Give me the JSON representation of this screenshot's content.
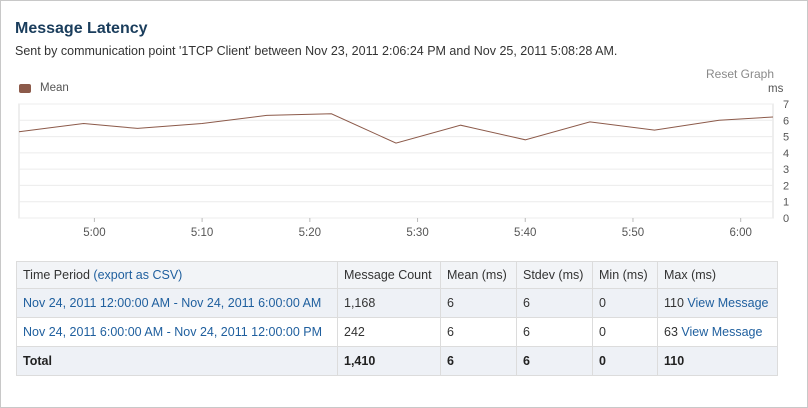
{
  "header": {
    "title": "Message Latency",
    "subtitle": "Sent by communication point '1TCP Client' between Nov 23, 2011 2:06:24 PM and Nov 25, 2011 5:08:28 AM."
  },
  "chart_controls": {
    "reset_label": "Reset Graph",
    "units_label": "ms"
  },
  "chart_data": {
    "type": "line",
    "x": [
      "4:53",
      "4:59",
      "5:04",
      "5:10",
      "5:16",
      "5:22",
      "5:28",
      "5:34",
      "5:40",
      "5:46",
      "5:52",
      "5:58",
      "6:03"
    ],
    "series": [
      {
        "name": "Mean",
        "color": "#8c5a4a",
        "values": [
          5.3,
          5.8,
          5.5,
          5.8,
          6.3,
          6.4,
          4.6,
          5.7,
          4.8,
          5.9,
          5.4,
          6.0,
          6.2
        ]
      }
    ],
    "xticks": [
      "5:00",
      "5:10",
      "5:20",
      "5:30",
      "5:40",
      "5:50",
      "6:00"
    ],
    "yticks": [
      "0",
      "1",
      "2",
      "3",
      "4",
      "5",
      "6",
      "7"
    ],
    "ylim": [
      0,
      7
    ],
    "grid": "horizontal",
    "legend": "top-left"
  },
  "table": {
    "headers": {
      "period": "Time Period",
      "export": "(export as CSV)",
      "count": "Message Count",
      "mean": "Mean (ms)",
      "stdev": "Stdev (ms)",
      "min": "Min (ms)",
      "max": "Max (ms)"
    },
    "rows": [
      {
        "period": "Nov 24, 2011 12:00:00 AM - Nov 24, 2011 6:00:00 AM",
        "count": "1,168",
        "mean": "6",
        "stdev": "6",
        "min": "0",
        "max": "110",
        "view": "View Message"
      },
      {
        "period": "Nov 24, 2011 6:00:00 AM - Nov 24, 2011 12:00:00 PM",
        "count": "242",
        "mean": "6",
        "stdev": "6",
        "min": "0",
        "max": "63",
        "view": "View Message"
      }
    ],
    "total": {
      "label": "Total",
      "count": "1,410",
      "mean": "6",
      "stdev": "6",
      "min": "0",
      "max": "110"
    }
  }
}
